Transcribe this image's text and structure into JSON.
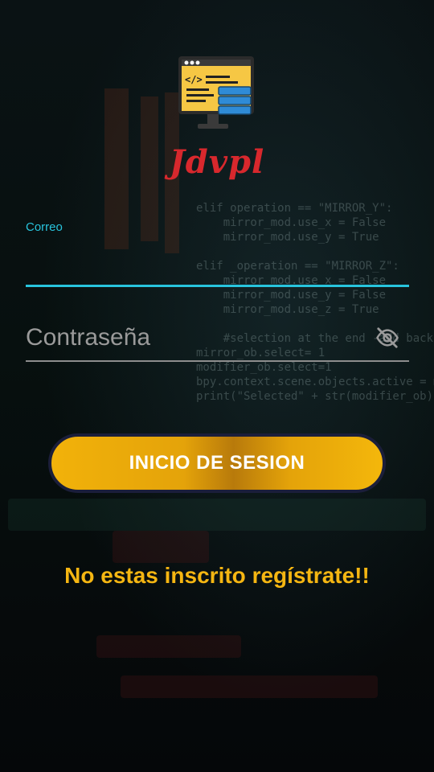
{
  "app": {
    "brand_name": "Jdvpl",
    "logo_icon": "code-monitor-server-icon"
  },
  "background": {
    "code_lines": [
      "elif operation == \"MIRROR_Y\":",
      "    mirror_mod.use_x = False",
      "    mirror_mod.use_y = True",
      "",
      "elif _operation == \"MIRROR_Z\":",
      "    mirror_mod.use_x = False",
      "    mirror_mod.use_y = False",
      "    mirror_mod.use_z = True",
      "",
      "    #selection at the end -add back",
      "mirror_ob.select= 1",
      "modifier_ob.select=1",
      "bpy.context.scene.objects.active = m",
      "print(\"Selected\" + str(modifier_ob))"
    ]
  },
  "form": {
    "email_label": "Correo",
    "email_value": "",
    "password_placeholder": "Contraseña",
    "password_value": "",
    "password_toggle_icon": "eye-off-icon"
  },
  "actions": {
    "login_label": "INICIO DE SESION",
    "register_text": "No estas inscrito regístrate!!"
  },
  "colors": {
    "accent_cyan": "#28c4dd",
    "button_gold": "#f2b20a",
    "register_gold": "#f5b612",
    "brand_red": "#d8282d",
    "background": "#05070b"
  }
}
